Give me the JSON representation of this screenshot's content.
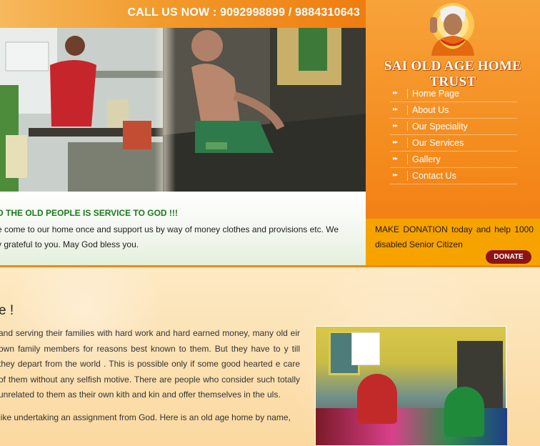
{
  "header": {
    "call_text": "CALL US NOW : 9092998899 / 9884310643"
  },
  "brand": {
    "name": "SAI OLD AGE HOME TRUST"
  },
  "nav": {
    "items": [
      {
        "label": "Home Page"
      },
      {
        "label": "About Us"
      },
      {
        "label": "Our Speciality"
      },
      {
        "label": "Our Services"
      },
      {
        "label": "Gallery"
      },
      {
        "label": "Contact Us"
      }
    ]
  },
  "intro": {
    "title": "D THE OLD PEOPLE IS SERVICE TO GOD !!!",
    "line1": "e come to our home once and support us by way of money clothes and provisions etc. We",
    "line2": "y grateful to you. May God bless you."
  },
  "donation": {
    "text": "MAKE DONATION today and help 1000 disabled Senior Citizen",
    "button_label": "DONATE"
  },
  "main": {
    "heading": "e !",
    "paragraph1": "and serving their families with hard work and hard earned money, many old eir own family members for reasons best known to them. But they have to y till they depart from the world . This is possible only if some good hearted e care of them without any selfish motive. There are people who consider such totally unrelated to them as their own kith and kin and offer themselves in the uls.",
    "paragraph2": "like undertaking an assignment from God. Here is an old age home by name,"
  },
  "colors": {
    "accent_orange": "#f48a1c",
    "donate_button": "#8c1414",
    "intro_title_green": "#1b7a1b"
  }
}
